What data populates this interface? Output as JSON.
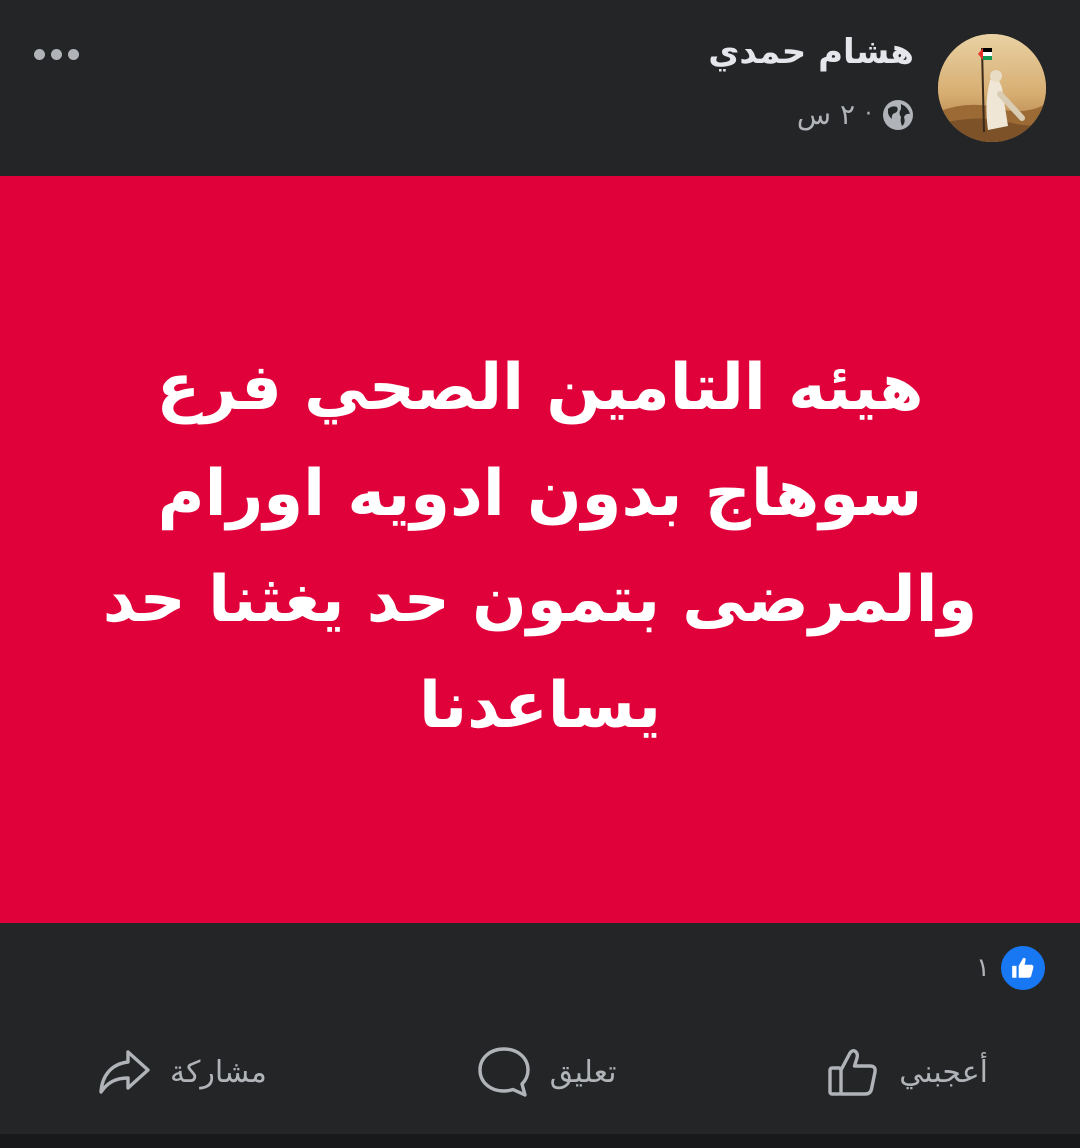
{
  "header": {
    "author_name": "هشام حمدي",
    "time": "٢ س",
    "separator": "·",
    "privacy_icon": "globe-icon",
    "avatar": "avatar-icon",
    "more_icon": "more-options-icon"
  },
  "content": {
    "background": "#e0003a",
    "text_color": "#ffffff",
    "lines": [
      "هيئه التامين الصحي فرع",
      "سوهاج بدون ادويه اورام",
      "والمرضى بتمون حد يغثنا حد",
      "يساعدنا"
    ]
  },
  "reactions": {
    "icon": "like-reaction-icon",
    "count": "١",
    "badge_color": "#1877f2"
  },
  "actions": {
    "like_label": "أعجبني",
    "comment_label": "تعليق",
    "share_label": "مشاركة"
  },
  "colors": {
    "background": "#242526",
    "text_primary": "#e4e6eb",
    "text_secondary": "#b0b3b8"
  }
}
